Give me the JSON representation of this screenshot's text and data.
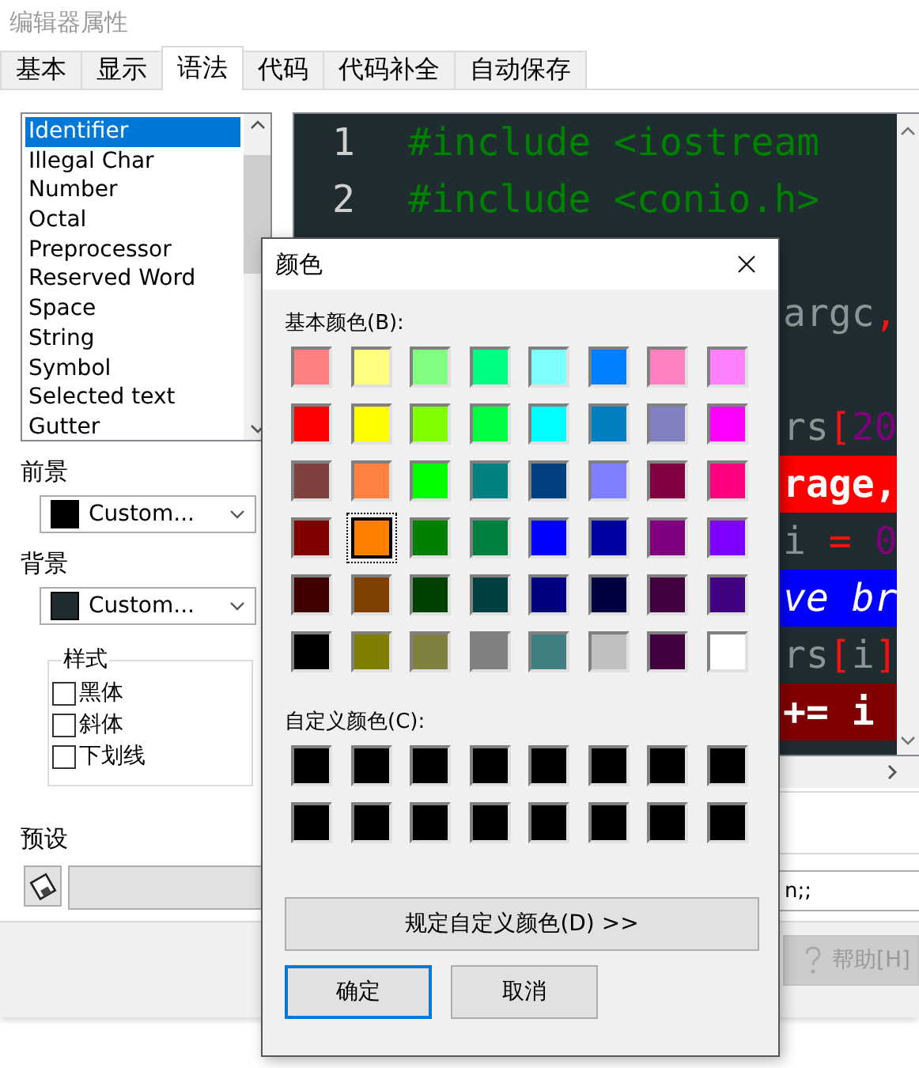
{
  "window": {
    "title": "编辑器属性"
  },
  "tabs": [
    {
      "label": "基本",
      "selected": false
    },
    {
      "label": "显示",
      "selected": false
    },
    {
      "label": "语法",
      "selected": true
    },
    {
      "label": "代码",
      "selected": false
    },
    {
      "label": "代码补全",
      "selected": false
    },
    {
      "label": "自动保存",
      "selected": false
    }
  ],
  "syntax_list": {
    "items": [
      {
        "label": "Identifier",
        "selected": true
      },
      {
        "label": "Illegal Char",
        "selected": false
      },
      {
        "label": "Number",
        "selected": false
      },
      {
        "label": "Octal",
        "selected": false
      },
      {
        "label": "Preprocessor",
        "selected": false
      },
      {
        "label": "Reserved Word",
        "selected": false
      },
      {
        "label": "Space",
        "selected": false
      },
      {
        "label": "String",
        "selected": false
      },
      {
        "label": "Symbol",
        "selected": false
      },
      {
        "label": "Selected text",
        "selected": false
      },
      {
        "label": "Gutter",
        "selected": false
      }
    ]
  },
  "foreground": {
    "label": "前景",
    "value": "Custom...",
    "color": "#000000"
  },
  "background": {
    "label": "背景",
    "value": "Custom...",
    "color": "#1f2d30"
  },
  "style_group": {
    "title": "样式",
    "options": [
      {
        "label": "黑体",
        "checked": false
      },
      {
        "label": "斜体",
        "checked": false
      },
      {
        "label": "下划线",
        "checked": false
      }
    ]
  },
  "preset": {
    "label": "预设"
  },
  "preview": {
    "lines": [
      {
        "kind": "code",
        "number": "1",
        "segments": [
          {
            "text": "#include <iostream",
            "kind": "preprocessor"
          }
        ]
      },
      {
        "kind": "code",
        "number": "2",
        "segments": [
          {
            "text": "#include <conio.h>",
            "kind": "preprocessor"
          }
        ]
      },
      {
        "kind": "blank"
      },
      {
        "kind": "code",
        "segments": [
          {
            "text": "argc",
            "kind": "plain"
          },
          {
            "text": ",",
            "kind": "symbol"
          }
        ]
      },
      {
        "kind": "blank"
      },
      {
        "kind": "code",
        "segments": [
          {
            "text": "rs",
            "kind": "plain"
          },
          {
            "text": "[",
            "kind": "symbol"
          },
          {
            "text": "20",
            "kind": "number"
          }
        ]
      },
      {
        "kind": "code",
        "color": "#ff0000",
        "segments": [
          {
            "text": "rage,",
            "kind": "bold"
          }
        ]
      },
      {
        "kind": "code",
        "segments": [
          {
            "text": "i",
            "kind": "plain"
          },
          {
            "text": " = ",
            "kind": "symbol"
          },
          {
            "text": "0",
            "kind": "number"
          }
        ]
      },
      {
        "kind": "code",
        "color": "#0000ff",
        "segments": [
          {
            "text": "ve br",
            "kind": "italic"
          }
        ]
      },
      {
        "kind": "code",
        "segments": [
          {
            "text": "rs",
            "kind": "plain"
          },
          {
            "text": "[",
            "kind": "symbol"
          },
          {
            "text": "i",
            "kind": "plain"
          },
          {
            "text": "]",
            "kind": "symbol"
          }
        ]
      },
      {
        "kind": "code",
        "color": "#800000",
        "segments": [
          {
            "text": "+= i",
            "kind": "bold"
          }
        ]
      }
    ]
  },
  "preview_field": {
    "value": "n;;"
  },
  "help_button": {
    "label": "帮助[H]",
    "disabled": true
  },
  "color_dialog": {
    "title": "颜色",
    "basic_label": "基本颜色(B):",
    "basic_colors": [
      {
        "color": "#ff8080",
        "selected": false
      },
      {
        "color": "#ffff80",
        "selected": false
      },
      {
        "color": "#80ff80",
        "selected": false
      },
      {
        "color": "#00ff80",
        "selected": false
      },
      {
        "color": "#80ffff",
        "selected": false
      },
      {
        "color": "#0080ff",
        "selected": false
      },
      {
        "color": "#ff80c0",
        "selected": false
      },
      {
        "color": "#ff80ff",
        "selected": false
      },
      {
        "color": "#ff0000",
        "selected": false
      },
      {
        "color": "#ffff00",
        "selected": false
      },
      {
        "color": "#80ff00",
        "selected": false
      },
      {
        "color": "#00ff40",
        "selected": false
      },
      {
        "color": "#00ffff",
        "selected": false
      },
      {
        "color": "#0080c0",
        "selected": false
      },
      {
        "color": "#8080c0",
        "selected": false
      },
      {
        "color": "#ff00ff",
        "selected": false
      },
      {
        "color": "#804040",
        "selected": false
      },
      {
        "color": "#ff8040",
        "selected": false
      },
      {
        "color": "#00ff00",
        "selected": false
      },
      {
        "color": "#008080",
        "selected": false
      },
      {
        "color": "#004080",
        "selected": false
      },
      {
        "color": "#8080ff",
        "selected": false
      },
      {
        "color": "#800040",
        "selected": false
      },
      {
        "color": "#ff0080",
        "selected": false
      },
      {
        "color": "#800000",
        "selected": false
      },
      {
        "color": "#ff8000",
        "selected": true
      },
      {
        "color": "#008000",
        "selected": false
      },
      {
        "color": "#008040",
        "selected": false
      },
      {
        "color": "#0000ff",
        "selected": false
      },
      {
        "color": "#0000a0",
        "selected": false
      },
      {
        "color": "#800080",
        "selected": false
      },
      {
        "color": "#8000ff",
        "selected": false
      },
      {
        "color": "#400000",
        "selected": false
      },
      {
        "color": "#804000",
        "selected": false
      },
      {
        "color": "#004000",
        "selected": false
      },
      {
        "color": "#004040",
        "selected": false
      },
      {
        "color": "#000080",
        "selected": false
      },
      {
        "color": "#000040",
        "selected": false
      },
      {
        "color": "#400040",
        "selected": false
      },
      {
        "color": "#400080",
        "selected": false
      },
      {
        "color": "#000000",
        "selected": false
      },
      {
        "color": "#808000",
        "selected": false
      },
      {
        "color": "#808040",
        "selected": false
      },
      {
        "color": "#808080",
        "selected": false
      },
      {
        "color": "#408080",
        "selected": false
      },
      {
        "color": "#c0c0c0",
        "selected": false
      },
      {
        "color": "#400040",
        "selected": false
      },
      {
        "color": "#ffffff",
        "selected": false
      }
    ],
    "custom_label": "自定义颜色(C):",
    "custom_colors": [
      {
        "color": "#000000"
      },
      {
        "color": "#000000"
      },
      {
        "color": "#000000"
      },
      {
        "color": "#000000"
      },
      {
        "color": "#000000"
      },
      {
        "color": "#000000"
      },
      {
        "color": "#000000"
      },
      {
        "color": "#000000"
      },
      {
        "color": "#000000"
      },
      {
        "color": "#000000"
      },
      {
        "color": "#000000"
      },
      {
        "color": "#000000"
      },
      {
        "color": "#000000"
      },
      {
        "color": "#000000"
      },
      {
        "color": "#000000"
      },
      {
        "color": "#000000"
      }
    ],
    "define_button": "规定自定义颜色(D) >>",
    "buttons": [
      {
        "label": "确定",
        "default": true
      },
      {
        "label": "取消",
        "default": false
      }
    ]
  }
}
